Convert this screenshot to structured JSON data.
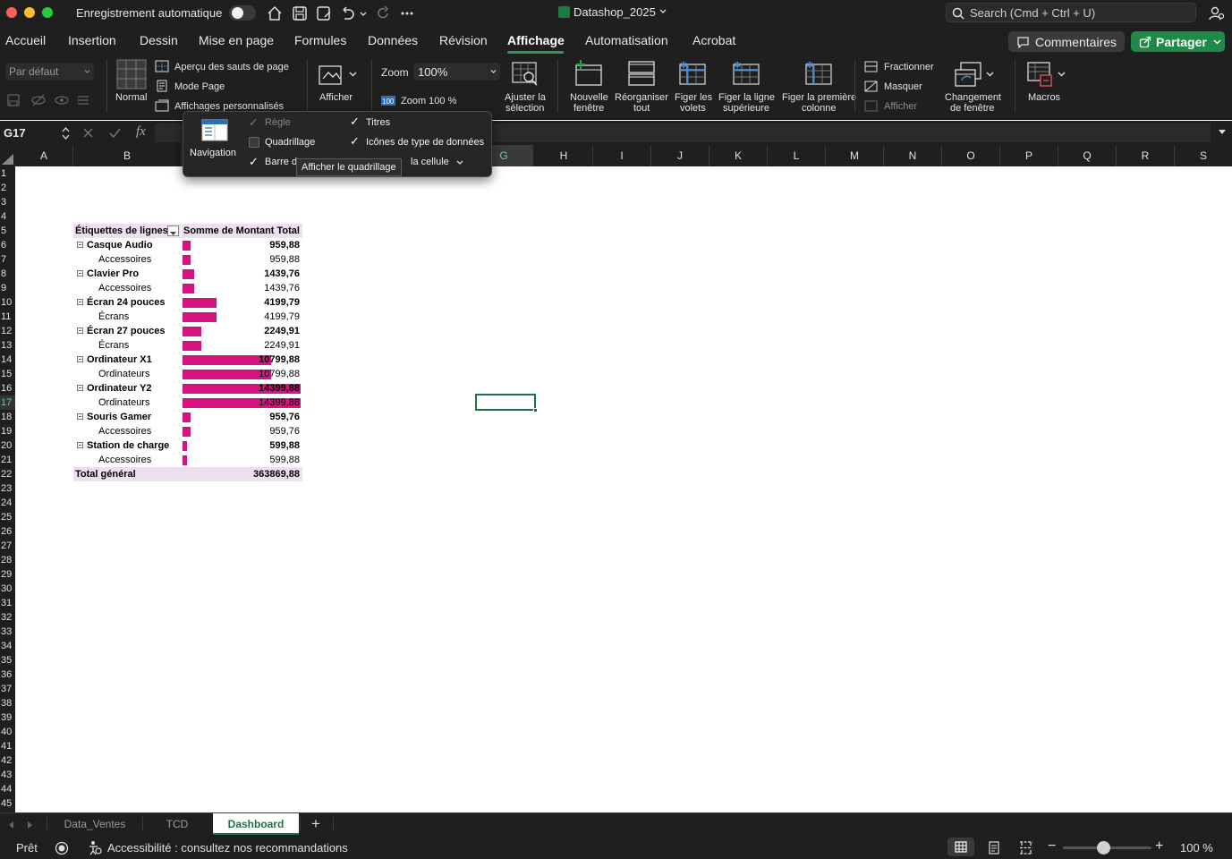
{
  "titlebar": {
    "autosave_label": "Enregistrement automatique",
    "doc_title": "Datashop_2025",
    "search_placeholder": "Search (Cmd + Ctrl + U)"
  },
  "menu": {
    "tabs": [
      "Accueil",
      "Insertion",
      "Dessin",
      "Mise en page",
      "Formules",
      "Données",
      "Révision",
      "Affichage",
      "Automatisation",
      "Acrobat"
    ],
    "active_tab": "Affichage",
    "comments_label": "Commentaires",
    "share_label": "Partager"
  },
  "ribbon": {
    "view_select": "Par défaut",
    "normal": "Normal",
    "page_break_preview": "Aperçu des sauts de page",
    "page_mode": "Mode Page",
    "custom_views": "Affichages personnalisés",
    "afficher": "Afficher",
    "zoom_label": "Zoom",
    "zoom_value": "100%",
    "zoom_100": "Zoom 100 %",
    "zoom_to_selection_1": "Ajuster la",
    "zoom_to_selection_2": "sélection",
    "new_window_1": "Nouvelle",
    "new_window_2": "fenêtre",
    "arrange_all_1": "Réorganiser",
    "arrange_all_2": "tout",
    "freeze_panes_1": "Figer les",
    "freeze_panes_2": "volets",
    "freeze_top_row_1": "Figer la ligne",
    "freeze_top_row_2": "supérieure",
    "freeze_first_col_1": "Figer la première",
    "freeze_first_col_2": "colonne",
    "split": "Fractionner",
    "hide": "Masquer",
    "unhide": "Afficher",
    "switch_window_1": "Changement",
    "switch_window_2": "de fenêtre",
    "macros": "Macros"
  },
  "formula_bar": {
    "name_box": "G17",
    "fx": "fx"
  },
  "popup": {
    "navigation": "Navigation",
    "ruler": "Règle",
    "gridlines": "Quadrillage",
    "formula_bar": "Barre d",
    "headings": "Titres",
    "data_type_icons": "Icônes de type de données",
    "cell_suffix": "la cellule",
    "tooltip": "Afficher le quadrillage",
    "ruler_checked": true,
    "gridlines_checked": false,
    "formula_bar_checked": true,
    "headings_checked": true,
    "data_type_icons_checked": true
  },
  "columns": [
    "A",
    "B",
    "C",
    "D",
    "E",
    "F",
    "G",
    "H",
    "I",
    "J",
    "K",
    "L",
    "M",
    "N",
    "O",
    "P",
    "Q",
    "R",
    "S"
  ],
  "rows": [
    "1",
    "2",
    "3",
    "4",
    "5",
    "6",
    "7",
    "8",
    "9",
    "10",
    "11",
    "12",
    "13",
    "14",
    "15",
    "16",
    "17",
    "18",
    "19",
    "20",
    "21",
    "22",
    "23",
    "24",
    "25",
    "26",
    "27",
    "28",
    "29",
    "30",
    "31",
    "32",
    "33",
    "34",
    "35",
    "36",
    "37",
    "38",
    "39",
    "40",
    "41",
    "42",
    "43",
    "44",
    "45"
  ],
  "pivot": {
    "header_label": "Étiquettes de lignes",
    "header_value": "Somme de Montant Total",
    "bar_color": "#d5127f",
    "max_value": 14399.88,
    "rows": [
      {
        "label": "Casque Audio",
        "value": "959,88",
        "num": 959.88,
        "level": 0
      },
      {
        "label": "Accessoires",
        "value": "959,88",
        "num": 959.88,
        "level": 1
      },
      {
        "label": "Clavier Pro",
        "value": "1439,76",
        "num": 1439.76,
        "level": 0
      },
      {
        "label": "Accessoires",
        "value": "1439,76",
        "num": 1439.76,
        "level": 1
      },
      {
        "label": "Écran 24 pouces",
        "value": "4199,79",
        "num": 4199.79,
        "level": 0
      },
      {
        "label": "Écrans",
        "value": "4199,79",
        "num": 4199.79,
        "level": 1
      },
      {
        "label": "Écran 27 pouces",
        "value": "2249,91",
        "num": 2249.91,
        "level": 0
      },
      {
        "label": "Écrans",
        "value": "2249,91",
        "num": 2249.91,
        "level": 1
      },
      {
        "label": "Ordinateur X1",
        "value": "10799,88",
        "num": 10799.88,
        "level": 0
      },
      {
        "label": "Ordinateurs",
        "value": "10799,88",
        "num": 10799.88,
        "level": 1
      },
      {
        "label": "Ordinateur Y2",
        "value": "14399,88",
        "num": 14399.88,
        "level": 0
      },
      {
        "label": "Ordinateurs",
        "value": "14399,88",
        "num": 14399.88,
        "level": 1
      },
      {
        "label": "Souris Gamer",
        "value": "959,76",
        "num": 959.76,
        "level": 0
      },
      {
        "label": "Accessoires",
        "value": "959,76",
        "num": 959.76,
        "level": 1
      },
      {
        "label": "Station de charge",
        "value": "599,88",
        "num": 599.88,
        "level": 0
      },
      {
        "label": "Accessoires",
        "value": "599,88",
        "num": 599.88,
        "level": 1
      }
    ],
    "total_label": "Total général",
    "total_value": "363869,88"
  },
  "sheets": {
    "tabs": [
      "Data_Ventes",
      "TCD",
      "Dashboard"
    ],
    "active": "Dashboard",
    "add": "+"
  },
  "status": {
    "ready": "Prêt",
    "accessibility": "Accessibilité : consultez nos recommandations",
    "zoom": "100 %",
    "zoom_level_fraction": 0.45
  }
}
